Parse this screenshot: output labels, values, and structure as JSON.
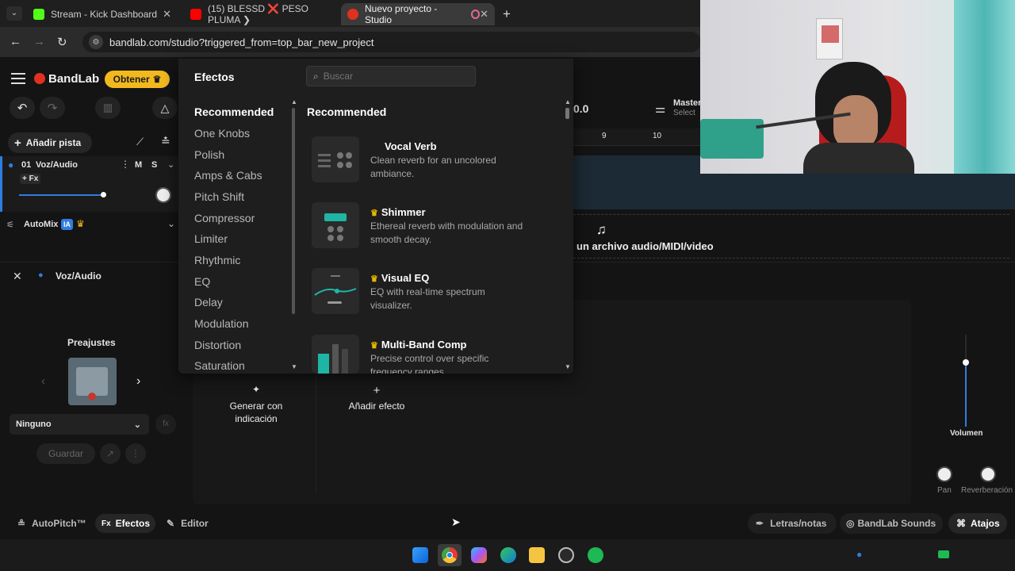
{
  "browser": {
    "tabs": [
      {
        "label": "Stream - Kick Dashboard",
        "favicon_color": "#53fc18"
      },
      {
        "label": "(15) BLESSD ❌ PESO PLUMA ❯",
        "favicon_color": "#ff0000"
      },
      {
        "label": "Nuevo proyecto - Studio",
        "favicon_color": "#e0311f"
      }
    ],
    "url": "bandlab.com/studio?triggered_from=top_bar_new_project",
    "new_tab": "+",
    "close_glyph": "✕"
  },
  "app": {
    "brand": "BandLab",
    "upgrade_label": "Obtener",
    "add_track_label": "Añadir pista",
    "track": {
      "number": "01",
      "name": "Voz/Audio",
      "fx_label": "+ Fx",
      "mute": "M",
      "solo": "S"
    },
    "automix_label": "AutoMix",
    "ia_badge": "IA",
    "master_label": "Master",
    "master_sub": "Select",
    "tempo_value": "0.0",
    "ruler": [
      "9",
      "10"
    ],
    "drop_hint": "un archivo audio/MIDI/video",
    "panel_title": "Voz/Audio",
    "presets_label": "Preajustes",
    "preset_select": "Ninguno",
    "save_label": "Guardar",
    "generate_label": "Generar con indicación",
    "add_effect_label": "Añadir efecto",
    "volume_label": "Volumen",
    "pan_label": "Pan",
    "reverb_label": "Reverberación",
    "bottom_tabs": [
      "AutoPitch™",
      "Efectos",
      "Editor"
    ],
    "bottom_right": [
      "Letras/notas",
      "BandLab Sounds",
      "Atajos"
    ],
    "volume_level": 0.68
  },
  "effects_popup": {
    "title": "Efectos",
    "search_placeholder": "Buscar",
    "categories": [
      "Recommended",
      "One Knobs",
      "Polish",
      "Amps & Cabs",
      "Pitch Shift",
      "Compressor",
      "Limiter",
      "Rhythmic",
      "EQ",
      "Delay",
      "Modulation",
      "Distortion",
      "Saturation"
    ],
    "section_title": "Recommended",
    "items": [
      {
        "name": "Vocal Verb",
        "desc": "Clean reverb for an uncolored ambiance.",
        "premium": false
      },
      {
        "name": "Shimmer",
        "desc": "Ethereal reverb with modulation and smooth decay.",
        "premium": true
      },
      {
        "name": "Visual EQ",
        "desc": "EQ with real-time spectrum visualizer.",
        "premium": true
      },
      {
        "name": "Multi-Band Comp",
        "desc": "Precise control over specific frequency ranges.",
        "premium": true
      }
    ]
  },
  "colors": {
    "accent": "#f2b91f",
    "brand_red": "#e0311f",
    "teal": "#1fb5a5",
    "blue": "#2f7de1"
  }
}
